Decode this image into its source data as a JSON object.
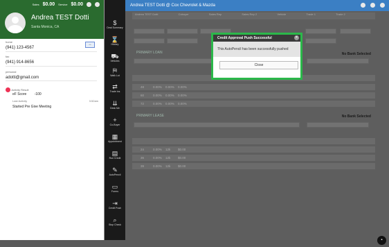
{
  "contact": {
    "sales_label": "Sales",
    "sales_value": "$0.00",
    "service_label": "Service",
    "service_value": "$0.00",
    "name": "Andrea TEST Dotti",
    "location": "Santa Monica, CA",
    "home_label": "home",
    "home_value": "(941) 123-4567",
    "fax_label": "fax",
    "fax_value": "(941) 914-8656",
    "personal_label": "personal",
    "personal_value": "adotti@gmail.com",
    "activity_label": "Activity Result",
    "activity_value": "eF Score",
    "activity_score": "-100",
    "last_activity_label": "Last Activity",
    "last_activity_value": "Started Pre Give Meeting",
    "last_activity_time": "3:52am"
  },
  "sidebar": [
    {
      "label": "Deal Summary",
      "icon": "dollar-icon"
    },
    {
      "label": "History",
      "icon": "history-icon"
    },
    {
      "label": "Vehicles",
      "icon": "car-icon"
    },
    {
      "label": "Walk Lot",
      "icon": "walk-icon"
    },
    {
      "label": "Trade Ins",
      "icon": "trade-icon"
    },
    {
      "label": "Desk Me",
      "icon": "desk-icon"
    },
    {
      "label": "Co-Buyer",
      "icon": "add-person-icon"
    },
    {
      "label": "Appointment",
      "icon": "calendar-icon"
    },
    {
      "label": "Run Credit",
      "icon": "credit-icon"
    },
    {
      "label": "AutoPencil",
      "icon": "pencil-icon"
    },
    {
      "label": "Forms",
      "icon": "forms-icon"
    },
    {
      "label": "Credit Push",
      "icon": "push-icon"
    },
    {
      "label": "Stop Check",
      "icon": "search-icon"
    }
  ],
  "deal": {
    "title": "Andrea TEST Dotti @ Cox Chevrolet & Mazda",
    "headers": [
      "Andrea TEST Dotti",
      "Cobuyer",
      "Sales Rep",
      "Sales Rep 2",
      "Vehicle",
      "Trade 1",
      "Trade 2"
    ],
    "primary_loan": "PRIMARY LOAN",
    "primary_lease": "PRIMARY LEASE",
    "no_bank": "No Bank Selected",
    "loan_rows": [
      {
        "term": "48",
        "rate": "0.00%",
        "a": "0.00%",
        "b": "0.00%"
      },
      {
        "term": "60",
        "rate": "0.00%",
        "a": "0.00%",
        "b": "0.00%"
      },
      {
        "term": "72",
        "rate": "0.00%",
        "a": "0.00%",
        "b": "0.00%"
      }
    ],
    "lease_rows": [
      {
        "term": "24",
        "rate": "0.00%",
        "miles": "12k",
        "b": "$0.00"
      },
      {
        "term": "36",
        "rate": "0.00%",
        "miles": "12k",
        "b": "$0.00"
      },
      {
        "term": "39",
        "rate": "0.00%",
        "miles": "12k",
        "b": "$0.00"
      }
    ]
  },
  "modal": {
    "title": "Credit Approval Push Successful",
    "message": "This AutoPencil has been successfully pushed",
    "close_label": "Close"
  },
  "colors": {
    "header_green": "#2a6b2f",
    "deal_blue": "#3b7fc4",
    "modal_border": "#2bb84a"
  }
}
